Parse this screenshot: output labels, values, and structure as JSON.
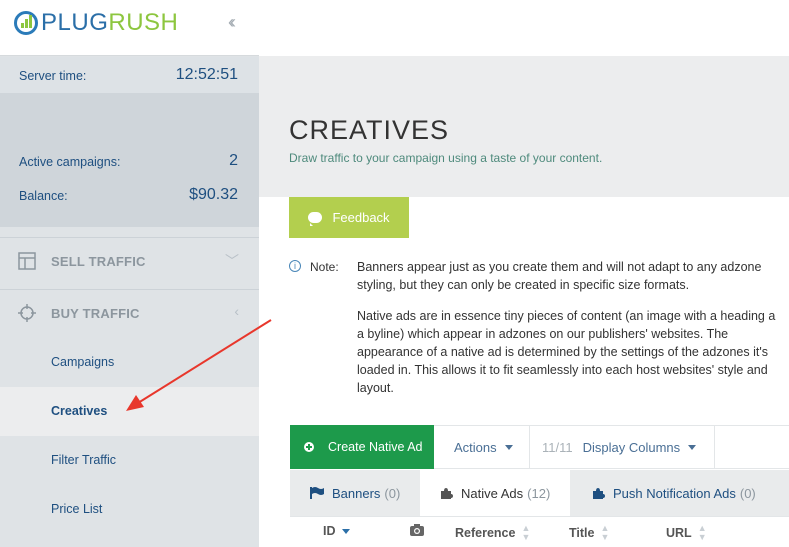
{
  "brand": {
    "part1": "PLUG",
    "part2": "RUSH"
  },
  "sidebar": {
    "server_time_label": "Server time:",
    "server_time_value": "12:52:51",
    "active_campaigns_label": "Active campaigns:",
    "active_campaigns_value": "2",
    "balance_label": "Balance:",
    "balance_value": "$90.32",
    "sell_traffic": "SELL TRAFFIC",
    "buy_traffic": "BUY TRAFFIC",
    "sub_items": [
      "Campaigns",
      "Creatives",
      "Filter Traffic",
      "Price List"
    ],
    "active_item": "Creatives"
  },
  "page": {
    "title": "CREATIVES",
    "subtitle": "Draw traffic to your campaign using a taste of your content.",
    "feedback_label": "Feedback",
    "note_label": "Note:",
    "note_para1_line1": "Banners appear just as you create them and will not adapt to any adzone",
    "note_para1_line2": "styling, but they can only be created in specific size formats.",
    "note_para2_line1": "Native ads are in essence tiny pieces of content (an image with a heading a",
    "note_para2_line2": "a byline) which appear in adzones on our publishers' websites. The",
    "note_para2_line3": "appearance of a native ad is determined by the settings of the adzones it's",
    "note_para2_line4": "loaded in. This allows it to fit seamlessly into each host websites' style and",
    "note_para2_line5": "layout."
  },
  "toolbar": {
    "create_label": "Create Native Ad",
    "actions_label": "Actions",
    "columns_count": "11/11",
    "columns_label": "Display Columns"
  },
  "tabs": [
    {
      "label": "Banners",
      "count": "(0)"
    },
    {
      "label": "Native Ads",
      "count": "(12)"
    },
    {
      "label": "Push Notification Ads",
      "count": "(0)"
    }
  ],
  "table": {
    "columns": [
      "ID",
      "Reference",
      "Title",
      "URL"
    ]
  },
  "colors": {
    "brand_blue": "#2b6fa8",
    "brand_green": "#8dc63f",
    "create_green": "#1d9a4b",
    "feedback_green": "#b3cf4e",
    "annotation_red": "#e8372c"
  }
}
